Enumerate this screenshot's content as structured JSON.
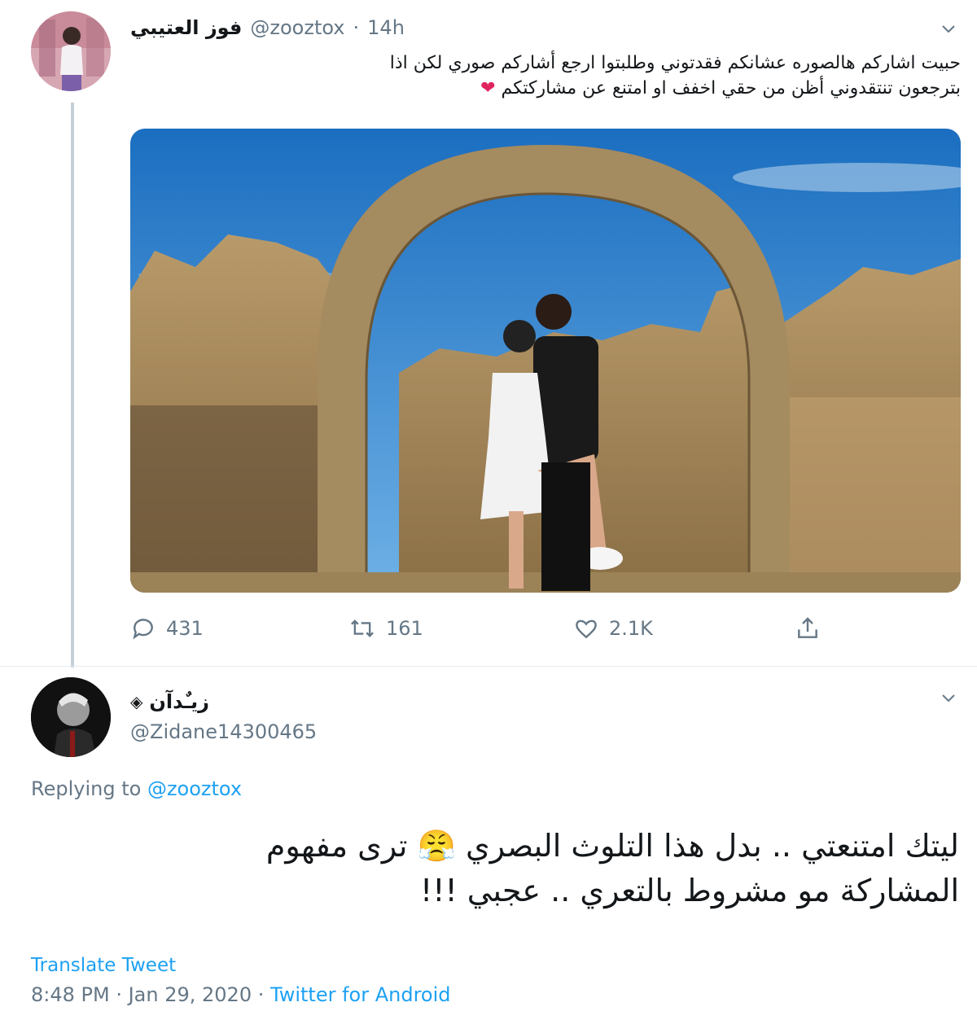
{
  "tweet1": {
    "display_name": "فوز العتيبي",
    "handle": "@zooztox",
    "separator": "·",
    "time": "14h",
    "text_line1": "حبيت اشاركم هالصوره عشانكم فقدتوني وطلبتوا ارجع أشاركم صوري لكن اذا",
    "text_line2": "بترجعون تنتقدوني أظن من حقي اخفف او امتنع عن مشاركتكم",
    "heart_emoji": "❤",
    "actions": {
      "replies": "431",
      "retweets": "161",
      "likes": "2.1K"
    }
  },
  "tweet2": {
    "display_name": "زيـٌدآن",
    "name_badge": "◈",
    "handle": "@Zidane14300465",
    "replying_to_label": "Replying to",
    "replying_to_handle": "@zooztox",
    "text_line1a": "ليتك امتنعتي .. بدل هذا التلوث البصري",
    "text_emoji": "😤",
    "text_line1b": "ترى مفهوم",
    "text_line2": "المشاركة مو مشروط بالتعري .. عجبي !!!",
    "translate_label": "Translate Tweet",
    "timestamp": "8:48 PM · Jan 29, 2020",
    "meta_separator": "·",
    "source": "Twitter for Android"
  },
  "colors": {
    "accent": "#1da1f2",
    "secondary_text": "#657786",
    "heart": "#e0245e",
    "thread_line": "#c4cfd6"
  },
  "icons": [
    "chevron-down-icon",
    "reply-icon",
    "retweet-icon",
    "like-icon",
    "share-icon",
    "verified-badge-icon"
  ]
}
